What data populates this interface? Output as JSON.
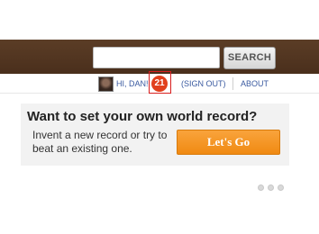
{
  "header": {
    "search": {
      "placeholder": "",
      "value": "",
      "button_label": "SEARCH"
    }
  },
  "user_bar": {
    "greeting": "HI, DAN!",
    "notification_count": "21",
    "sign_out_label": "(SIGN OUT)",
    "about_label": "ABOUT"
  },
  "promo": {
    "title": "Want to set your own world record?",
    "text": "Invent a new record or try to beat an existing one.",
    "cta_label": "Let's Go"
  },
  "carousel": {
    "dot_count": 3,
    "active_index": 0
  },
  "colors": {
    "header_brown": "#4a2f1c",
    "link_blue": "#3a5aa0",
    "badge_orange": "#e1401d",
    "cta_orange": "#f08a12",
    "highlight_red": "#d81e1e"
  }
}
